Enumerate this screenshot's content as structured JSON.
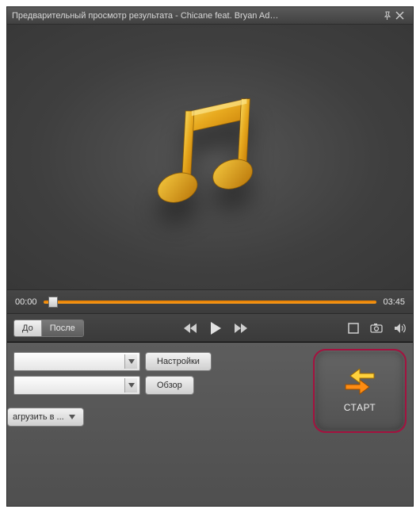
{
  "titlebar": {
    "title": "Предварительный просмотр результата - Chicane feat. Bryan Ad…"
  },
  "playback": {
    "current_time": "00:00",
    "total_time": "03:45"
  },
  "before_after": {
    "before_label": "До",
    "after_label": "После"
  },
  "panel": {
    "settings_label": "Настройки",
    "browse_label": "Обзор",
    "upload_label": "агрузить в ..."
  },
  "start": {
    "label": "СТАРТ"
  },
  "colors": {
    "accent": "#ff8c12",
    "highlight_border": "#a4123f"
  }
}
